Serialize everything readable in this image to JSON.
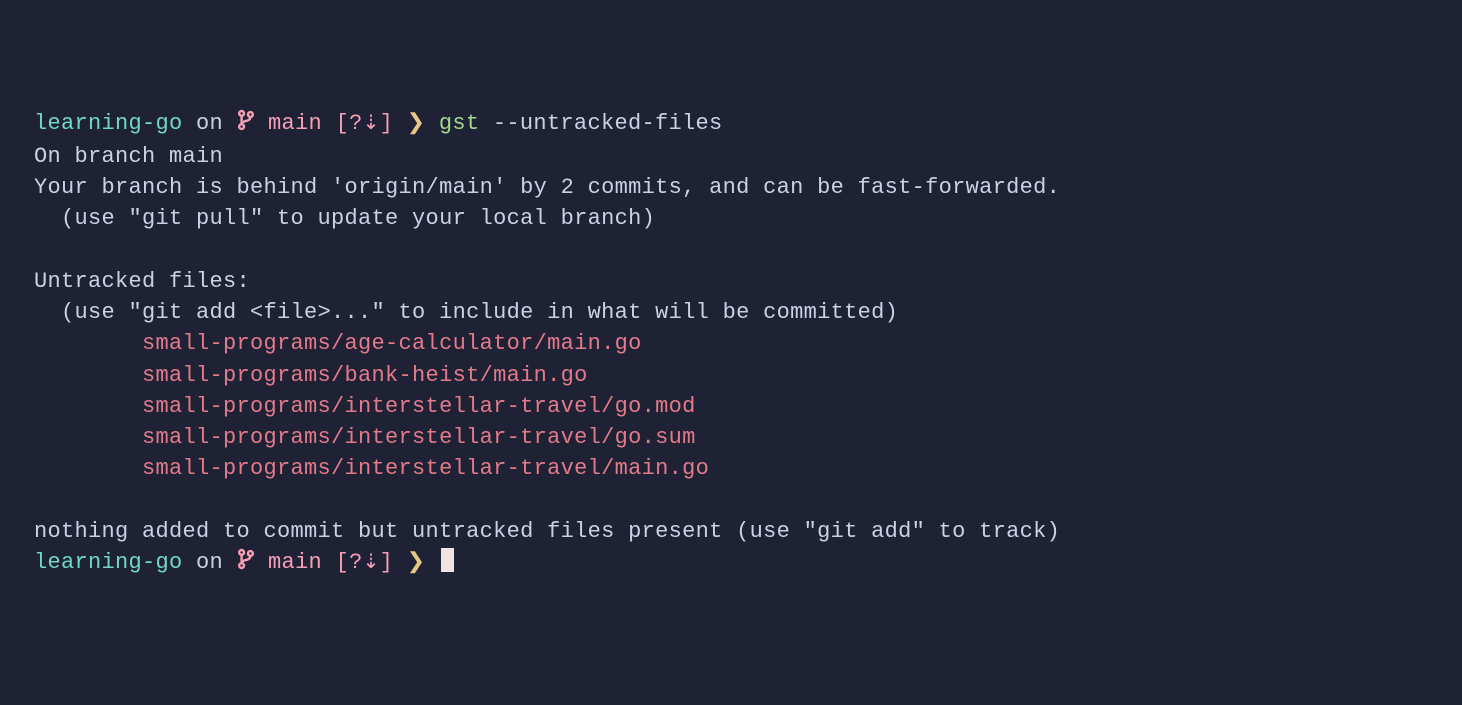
{
  "prompt1": {
    "dir": "learning-go",
    "on": " on ",
    "branch": " main",
    "status": " [?",
    "status_suffix": "]",
    "arrow": "⇣",
    "chevron": " ❯ ",
    "cmd_green": "gst",
    "cmd_gray": " --untracked-files"
  },
  "output": {
    "l1": "On branch main",
    "l2": "Your branch is behind 'origin/main' by 2 commits, and can be fast-forwarded.",
    "l3": "  (use \"git pull\" to update your local branch)",
    "l4": "",
    "l5": "Untracked files:",
    "l6": "  (use \"git add <file>...\" to include in what will be committed)",
    "files": [
      "        small-programs/age-calculator/main.go",
      "        small-programs/bank-heist/main.go",
      "        small-programs/interstellar-travel/go.mod",
      "        small-programs/interstellar-travel/go.sum",
      "        small-programs/interstellar-travel/main.go"
    ],
    "l7": "",
    "l8": "nothing added to commit but untracked files present (use \"git add\" to track)"
  },
  "prompt2": {
    "dir": "learning-go",
    "on": " on ",
    "branch": " main",
    "status": " [?",
    "status_suffix": "]",
    "arrow": "⇣",
    "chevron": " ❯ "
  }
}
